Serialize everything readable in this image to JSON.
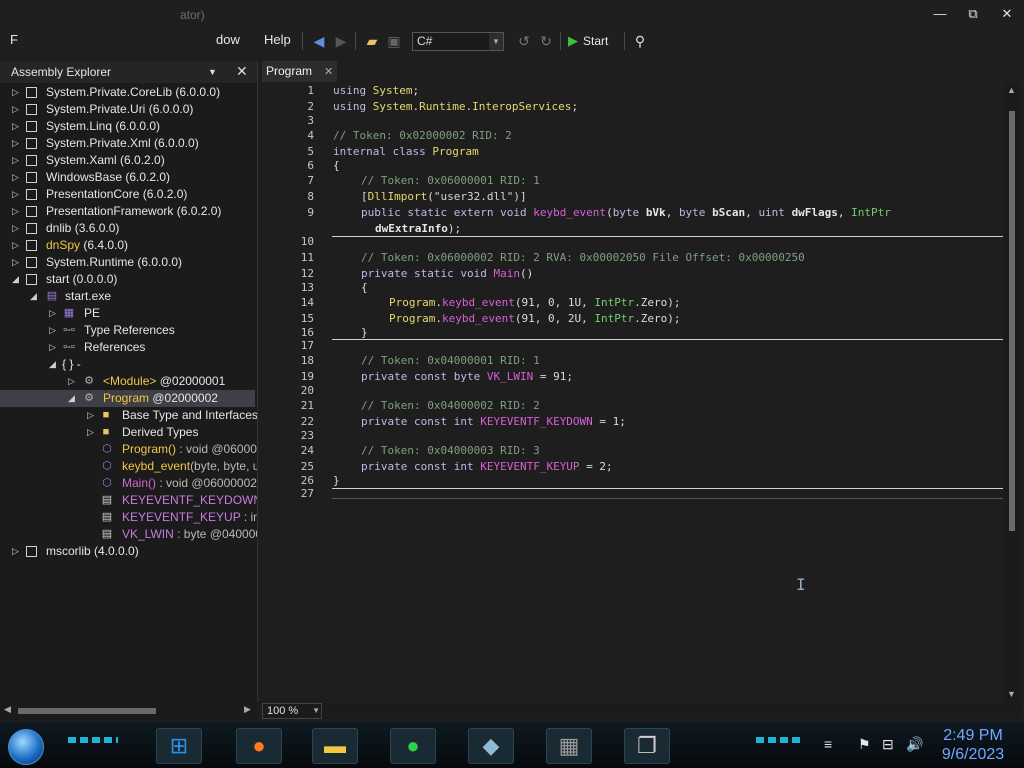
{
  "window": {
    "title_suffix": "ator)",
    "minimize": "—",
    "maximize": "⧉",
    "close": "✕"
  },
  "menu": {
    "first": "F",
    "window": "dow",
    "help": "Help"
  },
  "toolbar": {
    "language": "C#",
    "start": "Start"
  },
  "explorer": {
    "title": "Assembly Explorer",
    "tree": [
      {
        "text": "System.Private.CoreLib",
        "extra": " (6.0.0.0)"
      },
      {
        "text": "System.Private.Uri",
        "extra": " (6.0.0.0)"
      },
      {
        "text": "System.Linq",
        "extra": " (6.0.0.0)"
      },
      {
        "text": "System.Private.Xml",
        "extra": " (6.0.0.0)"
      },
      {
        "text": "System.Xaml",
        "extra": " (6.0.2.0)"
      },
      {
        "text": "WindowsBase",
        "extra": " (6.0.2.0)"
      },
      {
        "text": "PresentationCore",
        "extra": " (6.0.2.0)"
      },
      {
        "text": "PresentationFramework",
        "extra": " (6.0.2.0)"
      },
      {
        "text": "dnlib",
        "extra": " (3.6.0.0)"
      },
      {
        "text": "dnSpy",
        "extra": " (6.4.0.0)"
      },
      {
        "text": "System.Runtime",
        "extra": " (6.0.0.0)"
      },
      {
        "text": "start",
        "extra": " (0.0.0.0)"
      },
      {
        "text": "start.exe",
        "extra": ""
      },
      {
        "text": "PE",
        "extra": ""
      },
      {
        "text": "Type References",
        "extra": ""
      },
      {
        "text": "References",
        "extra": ""
      },
      {
        "text": "{ }",
        "extra": "  -"
      },
      {
        "text": "<Module>",
        "extra": " @02000001"
      },
      {
        "text": "Program",
        "extra": " @02000002"
      },
      {
        "text": "Base Type and Interfaces",
        "extra": ""
      },
      {
        "text": "Derived Types",
        "extra": ""
      },
      {
        "text": "Program()",
        "extra": " : void @060000"
      },
      {
        "text": "keybd_event",
        "extra": "(byte, byte, u"
      },
      {
        "text": "Main()",
        "extra": " : void @06000002"
      },
      {
        "text": "KEYEVENTF_KEYDOWN",
        "extra": " :"
      },
      {
        "text": "KEYEVENTF_KEYUP",
        "extra": " : int @"
      },
      {
        "text": "VK_LWIN",
        "extra": " : byte @0400000"
      },
      {
        "text": "mscorlib",
        "extra": " (4.0.0.0)"
      }
    ]
  },
  "editor": {
    "tab_label": "Program",
    "zoom": "100 %",
    "lines": [
      {
        "n": "1"
      },
      {
        "n": "2"
      },
      {
        "n": "3"
      },
      {
        "n": "4"
      },
      {
        "n": "5"
      },
      {
        "n": "6"
      },
      {
        "n": "7"
      },
      {
        "n": "8"
      },
      {
        "n": "9"
      },
      {
        "n": "10"
      },
      {
        "n": "11"
      },
      {
        "n": "12"
      },
      {
        "n": "13"
      },
      {
        "n": "14"
      },
      {
        "n": "15"
      },
      {
        "n": "16"
      },
      {
        "n": "17"
      },
      {
        "n": "18"
      },
      {
        "n": "19"
      },
      {
        "n": "20"
      },
      {
        "n": "21"
      },
      {
        "n": "22"
      },
      {
        "n": "23"
      },
      {
        "n": "24"
      },
      {
        "n": "25"
      },
      {
        "n": "26"
      },
      {
        "n": "27"
      }
    ],
    "code": {
      "l1_kw": "using",
      "l1_ns": "System",
      "l1_end": ";",
      "l2_kw": "using",
      "l2_ns": "System.Runtime.InteropServices",
      "l2_end": ";",
      "l4": "// Token: 0x02000002 RID: 2",
      "l5_kw": "internal class",
      "l5_name": "Program",
      "l6": "{",
      "l7": "// Token: 0x06000001 RID: 1",
      "l8_a": "[",
      "l8_attr": "DllImport",
      "l8_b": "(\"user32.dll\")]",
      "l9_kw": "public static extern void",
      "l9_fn": "keybd_event",
      "l9_a": "(",
      "l9_t1": "byte",
      "l9_p1": "bVk",
      "l9_c1": ",",
      "l9_t2": "byte",
      "l9_p2": "bScan",
      "l9_c2": ",",
      "l9_t3": "uint",
      "l9_p3": "dwFlags",
      "l9_c3": ",",
      "l9_t4": "IntPtr",
      "l9b_p": "dwExtraInfo",
      "l9b_end": ");",
      "l11": "// Token: 0x06000002 RID: 2 RVA: 0x00002050 File Offset: 0x00000250",
      "l12_kw": "private static void",
      "l12_fn": "Main",
      "l12_end": "()",
      "l13": "{",
      "l14_cls": "Program",
      "l14_dot": ".",
      "l14_fn": "keybd_event",
      "l14_a": "(91, 0, 1U, ",
      "l14_t": "IntPtr",
      "l14_z": ".Zero);",
      "l15_cls": "Program",
      "l15_dot": ".",
      "l15_fn": "keybd_event",
      "l15_a": "(91, 0, 2U, ",
      "l15_t": "IntPtr",
      "l15_z": ".Zero);",
      "l16": "}",
      "l18": "// Token: 0x04000001 RID: 1",
      "l19_kw": "private const byte",
      "l19_name": "VK_LWIN",
      "l19_end": " = 91;",
      "l21": "// Token: 0x04000002 RID: 2",
      "l22_kw": "private const int",
      "l22_name": "KEYEVENTF_KEYDOWN",
      "l22_end": " = 1;",
      "l24": "// Token: 0x04000003 RID: 3",
      "l25_kw": "private const int",
      "l25_name": "KEYEVENTF_KEYUP",
      "l25_end": " = 2;",
      "l26": "}"
    }
  },
  "taskbar": {
    "time": "2:49 PM",
    "date": "9/6/2023",
    "apps": [
      "windows-logo",
      "firefox",
      "file-explorer",
      "spotify",
      "network-app",
      "wall-app",
      "task-view"
    ]
  }
}
